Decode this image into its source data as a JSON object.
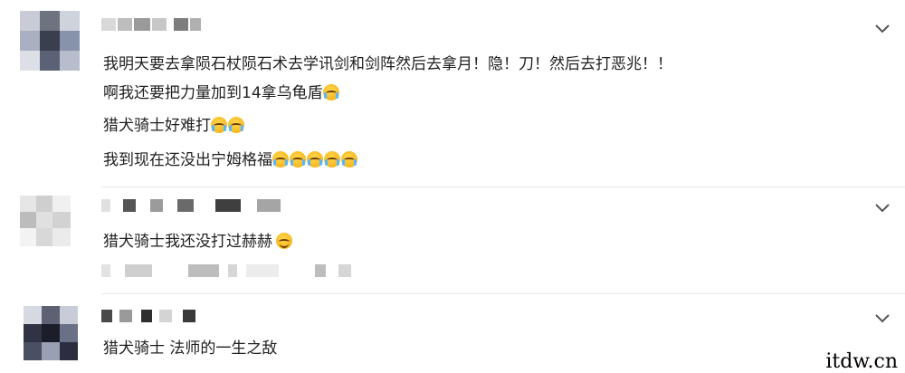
{
  "comments": [
    {
      "lines": [
        "我明天要去拿陨石杖陨石术去学讯剑和剑阵然后去拿月！隐！刀！然后去打恶兆！！",
        "啊我还要把力量加到14拿乌龟盾",
        "猎犬骑士好难打",
        "我到现在还没出宁姆格福"
      ]
    },
    {
      "lines": [
        "猎犬骑士我还没打过赫赫"
      ]
    },
    {
      "lines": [
        "猎犬骑士 法师的一生之敌"
      ]
    }
  ],
  "icons": {
    "expand": "chevron-down-icon",
    "cry": "loudly-crying-face-icon",
    "smile": "smiling-face-icon"
  },
  "watermark": "itdw.cn"
}
